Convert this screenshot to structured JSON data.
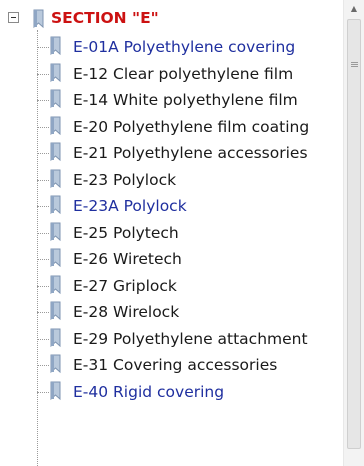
{
  "bookmarks": {
    "root": {
      "label": "SECTION \"E\"",
      "expanded": true,
      "color": "#cc1111"
    },
    "items": [
      {
        "label": "E-01A Polyethylene covering",
        "visited": true
      },
      {
        "label": "E-12 Clear polyethylene film",
        "visited": false
      },
      {
        "label": "E-14 White polyethylene film",
        "visited": false
      },
      {
        "label": "E-20 Polyethylene film coating",
        "visited": false
      },
      {
        "label": "E-21 Polyethylene accessories",
        "visited": false
      },
      {
        "label": "E-23 Polylock",
        "visited": false
      },
      {
        "label": "E-23A Polylock",
        "visited": true
      },
      {
        "label": "E-25 Polytech",
        "visited": false
      },
      {
        "label": "E-26 Wiretech",
        "visited": false
      },
      {
        "label": "E-27 Griplock",
        "visited": false
      },
      {
        "label": "E-28 Wirelock",
        "visited": false
      },
      {
        "label": "E-29 Polyethylene attachment",
        "visited": false
      },
      {
        "label": "E-31 Covering accessories",
        "visited": false
      },
      {
        "label": "E-40 Rigid covering",
        "visited": true
      }
    ]
  },
  "colors": {
    "visited_link": "#1f2f9f",
    "text": "#1a1a1a",
    "bookmark_icon": "#8fa6c4"
  },
  "icons": {
    "expander": "collapse-minus-icon",
    "bookmark": "bookmark-icon",
    "scroll_up": "scroll-up-arrow-icon"
  }
}
